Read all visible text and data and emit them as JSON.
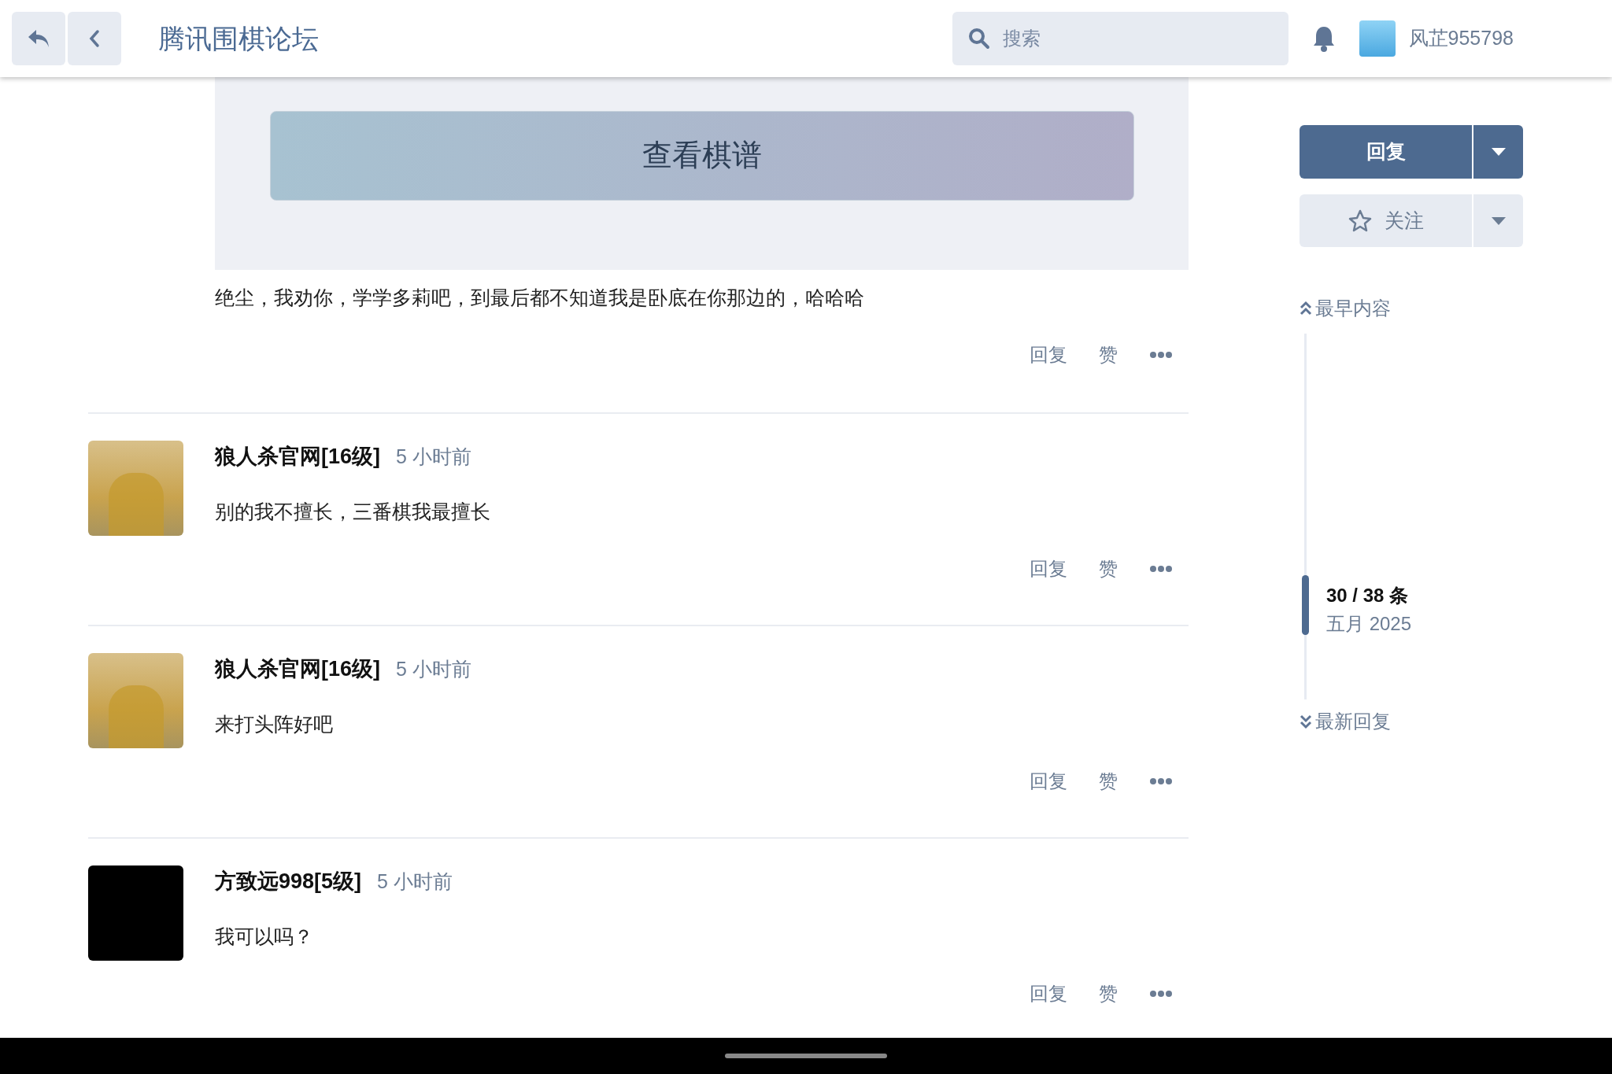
{
  "header": {
    "title": "腾讯围棋论坛",
    "search": {
      "placeholder": "搜索"
    },
    "username": "风芷955798"
  },
  "top_post": {
    "button": "查看棋谱",
    "body": "绝尘，我劝你，学学多莉吧，到最后都不知道我是卧底在你那边的，哈哈哈",
    "actions": [
      "回复",
      "赞"
    ]
  },
  "posts": [
    {
      "author": "狼人杀官网[16级]",
      "time": "5 小时前",
      "body": "别的我不擅长，三番棋我最擅长",
      "kind": "painting",
      "actions": [
        "回复",
        "赞"
      ]
    },
    {
      "author": "狼人杀官网[16级]",
      "time": "5 小时前",
      "body": "来打头阵好吧",
      "kind": "painting",
      "actions": [
        "回复",
        "赞"
      ]
    },
    {
      "author": "方致远998[5级]",
      "time": "5 小时前",
      "body": "我可以吗？",
      "kind": "dark",
      "actions": [
        "回复",
        "赞"
      ]
    }
  ],
  "sidebar": {
    "reply_button": "回复",
    "follow_button": "关注",
    "earliest": "最早内容",
    "progress": "30 / 38 条",
    "date": "五月 2025",
    "level": 0.79,
    "latest": "最新回复"
  }
}
